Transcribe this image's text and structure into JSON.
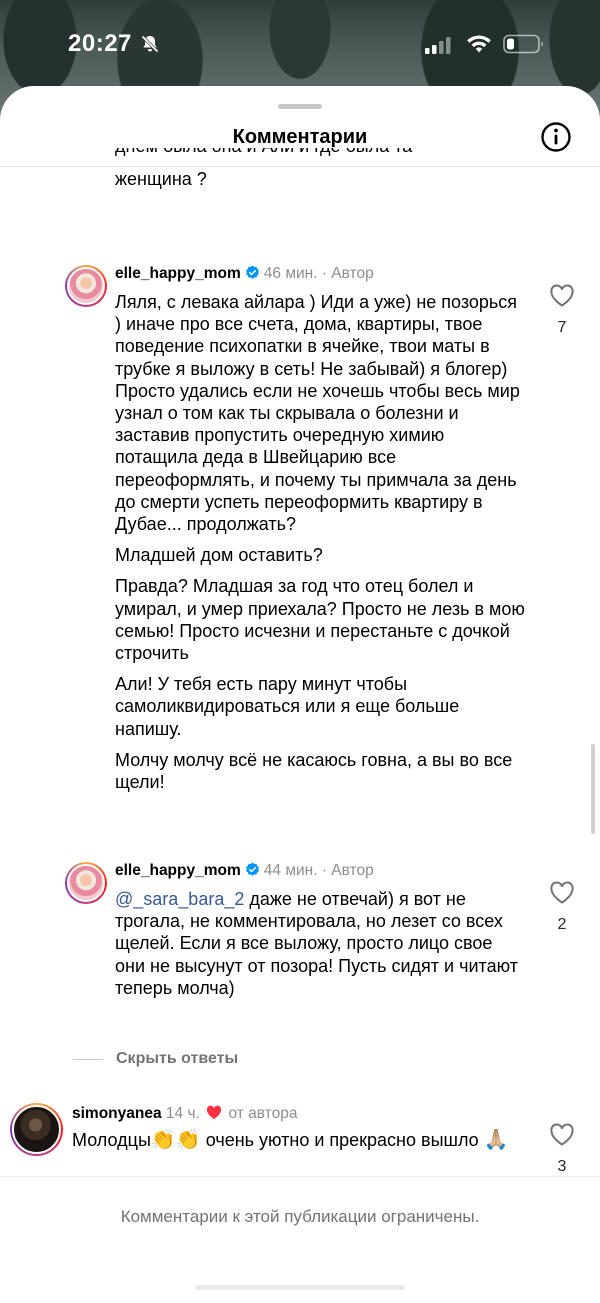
{
  "status": {
    "time": "20:27"
  },
  "header": {
    "title": "Комментарии"
  },
  "previous_comment_tail": {
    "line1": "днём была она и Али и где была та",
    "line2": "женщина ?"
  },
  "comments": [
    {
      "username": "elle_happy_mom",
      "time": "46 мин.",
      "author_label": "Автор",
      "paragraphs": [
        "Ляля, с левака айлара )  Иди а уже) не позорься ) иначе про все счета, дома, квартиры, твое поведение психопатки в ячейке, твои маты в трубке я выложу в сеть! Не забывай) я блогер) Просто удались если не хочешь чтобы весь мир узнал о том как ты скрывала о болезни и заставив пропустить очередную химию потащила деда в Швейцарию все переоформлять, и почему ты примчала за день до смерти успеть переоформить квартиру в Дубае... продолжать?",
        "Младшей дом оставить?",
        "Правда? Младшая за год что отец болел и умирал, и умер приехала? Просто не лезь в мою семью! Просто исчезни и перестаньте с дочкой строчить",
        "Али! У тебя есть пару минут чтобы самоликвидироваться или я еще больше напишу.",
        "Молчу молчу всё не касаюсь говна, а вы во все щели!"
      ],
      "likes": "7"
    },
    {
      "username": "elle_happy_mom",
      "time": "44 мин.",
      "author_label": "Автор",
      "mention": "@_sara_bara_2",
      "text": " даже не отвечай) я вот не трогала, не комментировала, но лезет со всех щелей. Если я все выложу, просто лицо свое они не высунут от позора! Пусть сидят и читают теперь молча)",
      "likes": "2"
    },
    {
      "username": "simonyanea",
      "time": "14 ч.",
      "from_author_label": "от автора",
      "text_before": "Молодцы",
      "emoji_clap": "👏👏",
      "text_after": " очень уютно и прекрасно вышло",
      "emoji_pray": "🙏🏼",
      "likes": "3"
    }
  ],
  "hide_replies_label": "Скрыть ответы",
  "footer": {
    "restricted_text": "Комментарии к этой публикации ограничены."
  },
  "colors": {
    "link": "#385898",
    "heart_red": "#ff3040",
    "verified_blue": "#0095f6"
  }
}
